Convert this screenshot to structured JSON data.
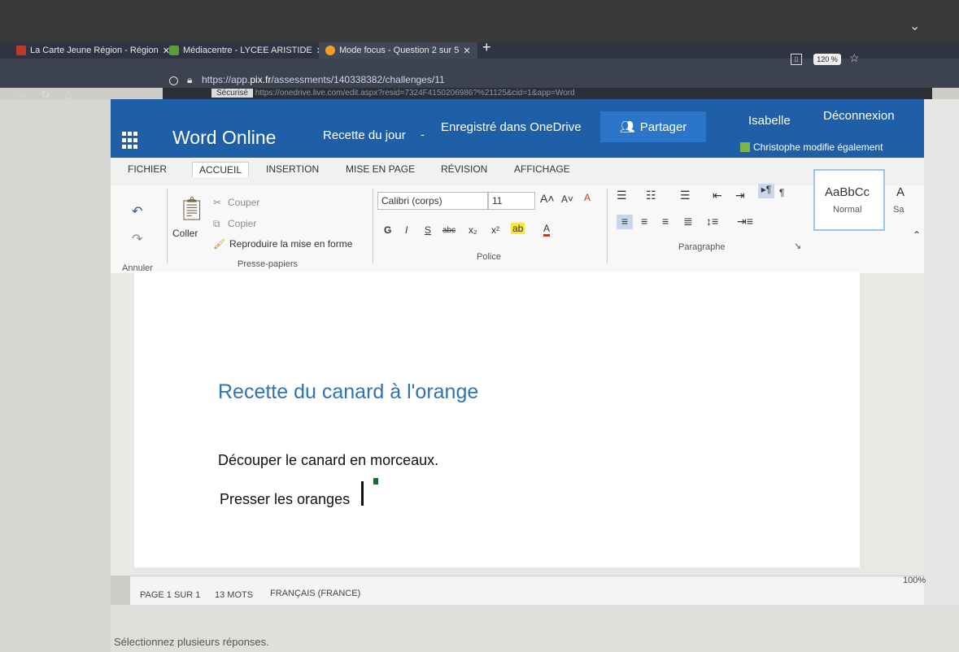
{
  "browser": {
    "tabs": [
      {
        "label": "La Carte Jeune Région - Région",
        "close": "✕",
        "color": "#c0392b"
      },
      {
        "label": "Médiacentre - LYCEE ARISTIDE",
        "close": "✕",
        "color": "#5a9e3b"
      },
      {
        "label": "Mode focus - Question 2 sur 5",
        "close": "✕",
        "color": "#f0a020"
      }
    ],
    "new_tab": "+",
    "zoom": "120 %",
    "url_prefix": "https://app.",
    "url_domain": "pix.fr",
    "url_rest": "/assessments/140338382/challenges/11",
    "inner_url_secure": "Sécurisé",
    "inner_url": "https://onedrive.live.com/edit.aspx?resid=7324F4150206986?%21125&cid=1&app=Word"
  },
  "header": {
    "app_title": "Word Online",
    "doc_title": "Recette du jour",
    "separator": "-",
    "doc_status": "Enregistré dans OneDrive",
    "share_label": "Partager",
    "user_name": "Isabelle",
    "logout_label": "Déconnexion",
    "coedit_text": "Christophe modifie également",
    "bg_color": "#1f5fa8"
  },
  "menu": {
    "items": [
      "FICHIER",
      "ACCUEIL",
      "INSERTION",
      "MISE EN PAGE",
      "RÉVISION",
      "AFFICHAGE"
    ],
    "active": "ACCUEIL"
  },
  "ribbon": {
    "undo_group_label": "Annuler",
    "paste_label": "Coller",
    "cut_label": "Couper",
    "copy_label": "Copier",
    "format_painter_label": "Reproduire la mise en forme",
    "clipboard_group_label": "Presse-papiers",
    "font_name": "Calibri (corps)",
    "font_size": "11",
    "font_group_label": "Police",
    "paragraph_group_label": "Paragraphe",
    "style_preview": "AaBbCc",
    "style_name": "Normal",
    "style_next_preview": "A",
    "style_next_name": "Sa",
    "bold": "G",
    "italic": "I",
    "underline": "S",
    "strike": "abc",
    "subscript": "x₂",
    "superscript": "x²"
  },
  "document": {
    "heading": "Recette du canard à l'orange",
    "lines": [
      "Découper le canard en morceaux.",
      "Presser les oranges"
    ]
  },
  "status": {
    "page": "PAGE 1 SUR 1",
    "words": "13 MOTS",
    "language": "FRANÇAIS (FRANCE)",
    "zoom": "100%"
  },
  "footer": {
    "instruction": "Sélectionnez plusieurs réponses."
  }
}
